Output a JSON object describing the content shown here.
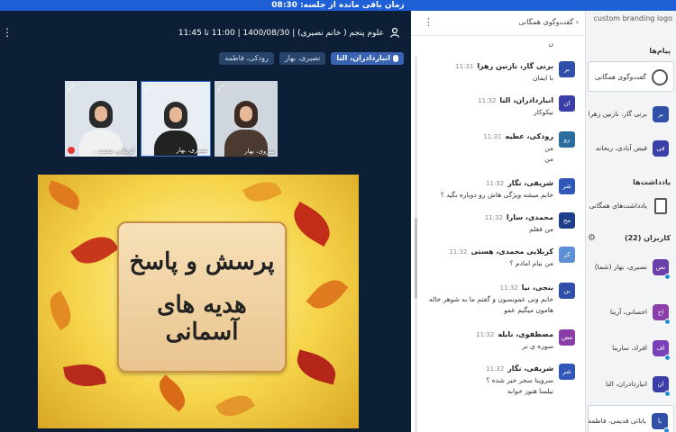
{
  "timer": {
    "text": "زمان باقی مانده از جلسه: 08:30"
  },
  "meeting": {
    "title": "علوم پنجم ( خانم نصیری) | 1400/08/30 | 11:00 تا 11:45",
    "speakers": [
      "انباردادران، النا",
      "نصیری، بهار",
      "رودکی، فاطمه"
    ]
  },
  "tiles": [
    {
      "name": "کربلایی محمد..."
    },
    {
      "name": "نصیری، بهار"
    },
    {
      "name": "سروی، بهار"
    }
  ],
  "slide": {
    "line1": "پرسش و پاسخ",
    "line2": "هدیه های آسمانی"
  },
  "chat": {
    "title": "گفت‌وگوی همگانی",
    "messages": [
      {
        "avatar": "",
        "who": "",
        "time": "",
        "lines": [
          "ن"
        ]
      },
      {
        "avatar": "بر",
        "who": "برنی گار، نازنین زهرا",
        "time": "11:31",
        "lines": [
          "با ایمان"
        ]
      },
      {
        "avatar": "ان",
        "who": "انباردادران، النا",
        "time": "11:32",
        "lines": [
          "نیکوکار"
        ]
      },
      {
        "avatar": "رو",
        "who": "رودکی، عطیه",
        "time": "11:31",
        "lines": [
          "من",
          "من"
        ]
      },
      {
        "avatar": "شر",
        "who": "شریفی، نگار",
        "time": "11:32",
        "lines": [
          "خانم میشه ویژگی هاش رو دوباره بگید ؟"
        ]
      },
      {
        "avatar": "مح",
        "who": "محمدی، سارا",
        "time": "11:32",
        "lines": [
          "من فقلم"
        ]
      },
      {
        "avatar": "کر",
        "who": "کربلایی محمدی، هستی",
        "time": "11:32",
        "lines": [
          "من نیام امادم ؟"
        ]
      },
      {
        "avatar": "بن",
        "who": "بنجی، نیا",
        "time": "11:32",
        "lines": [
          "خانم وتی عمونسون و گفتم ما به شوهر خاله",
          "هامون میگیم عمو"
        ]
      },
      {
        "avatar": "مص",
        "who": "مصطفوی، نایله",
        "time": "11:32",
        "lines": [
          "سوره ی نر"
        ]
      },
      {
        "avatar": "شر",
        "who": "شریفی، نگار",
        "time": "11:32",
        "lines": [
          "سروینا سحر خبر شده ؟",
          "نیلسا هنوز خوابه"
        ]
      }
    ]
  },
  "sidebar": {
    "brand": "custom branding logo",
    "messages_heading": "پیام‌ها",
    "public_chat": "گفت‌وگوی همگانی",
    "private_chats": [
      {
        "avatar": "بر",
        "label": "برنی گار، نازنین زهرا"
      },
      {
        "avatar": "فی",
        "label": "فیض آبادی، ریحانه"
      }
    ],
    "notes_heading": "یادداشت‌ها",
    "shared_notes": "یادداشت‌های همگانی",
    "users_heading": "کاربران (22)",
    "users": [
      {
        "avatar": "نص",
        "label": "نصیری، بهار (شما)"
      },
      {
        "avatar": "اح",
        "label": "احسانی، آرینا"
      },
      {
        "avatar": "اف",
        "label": "افراد، سارینا"
      },
      {
        "avatar": "ان",
        "label": "انباردادران، النا"
      },
      {
        "avatar": "با",
        "label": "بابائی قدیمی، فاطمه"
      }
    ]
  },
  "colors": {
    "accent": "#1e5fd6",
    "video_bg": "#0c1f36"
  }
}
